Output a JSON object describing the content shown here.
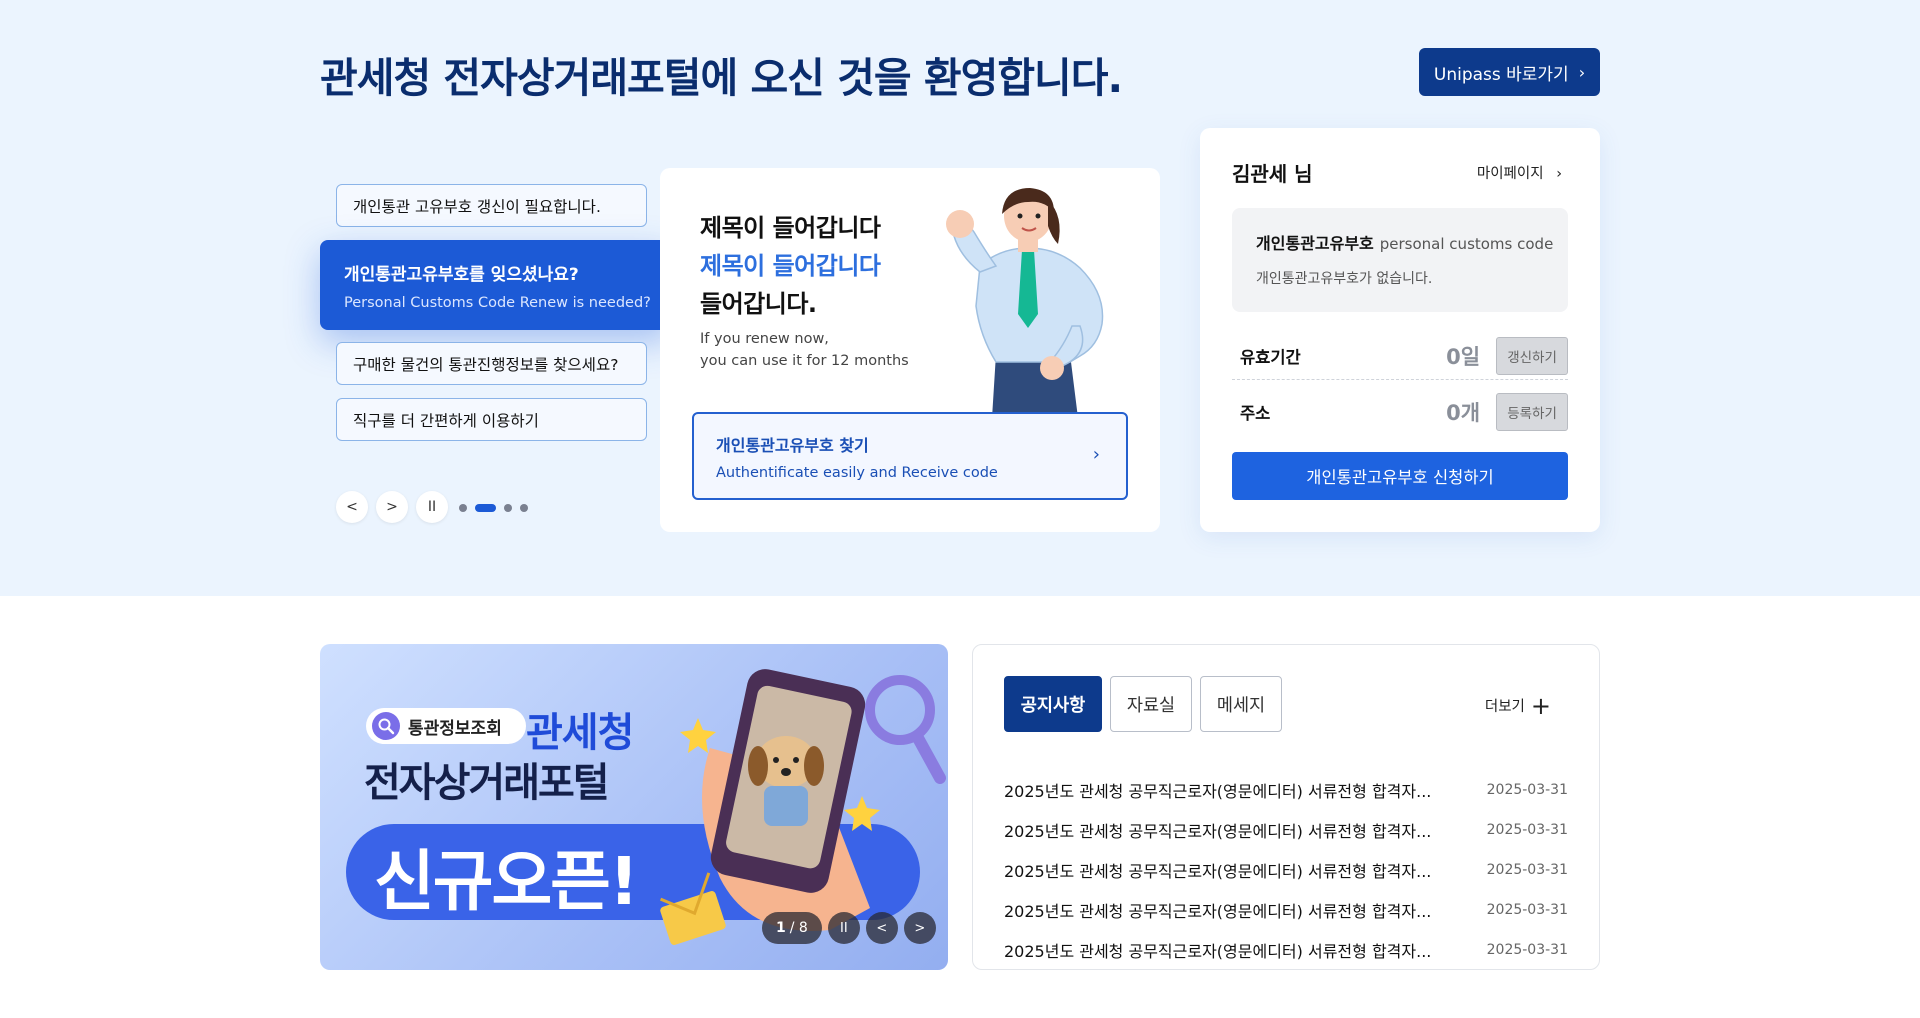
{
  "hero": {
    "title": "관세청 전자상거래포털에 오신 것을 환영합니다.",
    "unipass_label": "Unipass 바로가기"
  },
  "menu": {
    "items": [
      "개인통관 고유부호 갱신이 필요합니다.",
      "구매한 물건의 통관진행정보를 찾으세요?",
      "직구를 더 간편하게 이용하기"
    ],
    "active": {
      "title": "개인통관고유부호를 잊으셨나요?",
      "subtitle": "Personal Customs Code Renew is needed?"
    },
    "controls": {
      "prev": "<",
      "next": ">",
      "pause": "II"
    }
  },
  "slide": {
    "heading1": "제목이 들어갑니다",
    "heading2": "제목이 들어갑니다",
    "heading3": "들어갑니다.",
    "sub1": "If you renew now,",
    "sub2": "you can use it for 12 months",
    "find_title": "개인통관고유부호 찾기",
    "find_subtitle": "Authentificate easily and Receive code"
  },
  "user": {
    "name": "김관세 님",
    "mypage": "마이페이지",
    "code_label": "개인통관고유부호",
    "code_label_en": "personal customs code",
    "code_empty": "개인통관고유부호가 없습니다.",
    "validity_label": "유효기간",
    "validity_value": "0일",
    "renew_btn": "갱신하기",
    "address_label": "주소",
    "address_value": "0개",
    "register_btn": "등록하기",
    "apply_btn": "개인통관고유부호 신청하기"
  },
  "banner": {
    "pill": "통관정보조회",
    "brand": "관세청",
    "line2": "전자상거래포털",
    "open": "신규오픈!",
    "counter_current": "1",
    "counter_total": "/ 8",
    "pause": "II",
    "prev": "<",
    "next": ">"
  },
  "notices": {
    "tabs": [
      "공지사항",
      "자료실",
      "메세지"
    ],
    "more": "더보기",
    "items": [
      {
        "title": "2025년도 관세청 공무직근로자(영문에디터) 서류전형 합격자...",
        "date": "2025-03-31"
      },
      {
        "title": "2025년도 관세청 공무직근로자(영문에디터) 서류전형 합격자...",
        "date": "2025-03-31"
      },
      {
        "title": "2025년도 관세청 공무직근로자(영문에디터) 서류전형 합격자...",
        "date": "2025-03-31"
      },
      {
        "title": "2025년도 관세청 공무직근로자(영문에디터) 서류전형 합격자...",
        "date": "2025-03-31"
      },
      {
        "title": "2025년도 관세청 공무직근로자(영문에디터) 서류전형 합격자...",
        "date": "2025-03-31"
      }
    ]
  },
  "colors": {
    "primary": "#0d3a8c",
    "accent": "#1e63e0",
    "hero_bg": "#ebf4fe"
  }
}
